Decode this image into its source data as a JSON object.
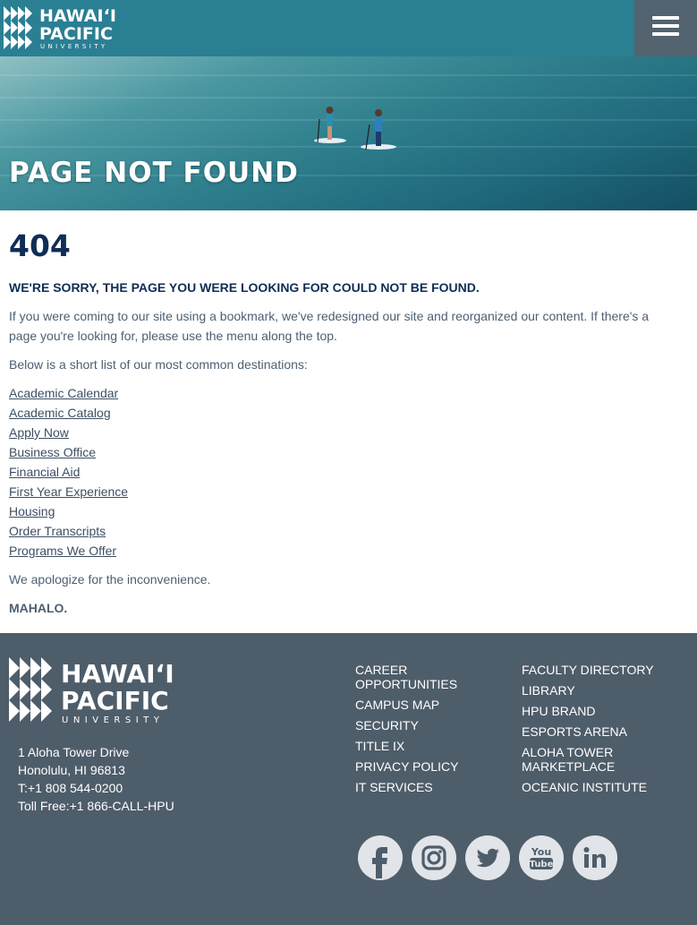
{
  "header": {
    "logo_alt": "Hawaiʻi Pacific University",
    "menu_icon": "hamburger-menu-icon"
  },
  "hero": {
    "title": "PAGE NOT FOUND"
  },
  "main": {
    "error_code": "404",
    "sorry": "WE'RE SORRY, THE PAGE YOU WERE LOOKING FOR COULD NOT BE FOUND.",
    "intro": "If you were coming to our site using a bookmark, we've redesigned our site and reorganized our content. If there's a page you're looking for, please use the menu along the top.",
    "list_intro": "Below is a short list of our most common destinations:",
    "links": [
      "Academic Calendar",
      "Academic Catalog",
      "Apply Now",
      "Business Office",
      "Financial Aid",
      "First Year Experience",
      "Housing",
      "Order Transcripts",
      "Programs We Offer"
    ],
    "apology": "We apologize for the inconvenience.",
    "mahalo": "MAHALO."
  },
  "footer": {
    "address": {
      "street": "1 Aloha Tower Drive",
      "city": "Honolulu, HI 96813",
      "phone": "T:+1 808 544-0200",
      "tollfree": "Toll Free:+1 866-CALL-HPU"
    },
    "col1": [
      "CAREER OPPORTUNITIES",
      "CAMPUS MAP",
      "SECURITY",
      "TITLE IX",
      "PRIVACY POLICY",
      "IT SERVICES"
    ],
    "col2": [
      "FACULTY DIRECTORY",
      "LIBRARY",
      "HPU BRAND",
      "ESPORTS ARENA",
      "ALOHA TOWER MARKETPLACE",
      "OCEANIC INSTITUTE"
    ],
    "social": [
      "facebook-icon",
      "instagram-icon",
      "twitter-icon",
      "youtube-icon",
      "linkedin-icon"
    ]
  },
  "colors": {
    "header_bg": "#2a7f93",
    "menu_bg": "#53636f",
    "heading_navy": "#0f2d56",
    "footer_bg": "#4e5d6a",
    "social_bg": "#e1e4e8",
    "social_glyph": "#4e5d6a"
  }
}
